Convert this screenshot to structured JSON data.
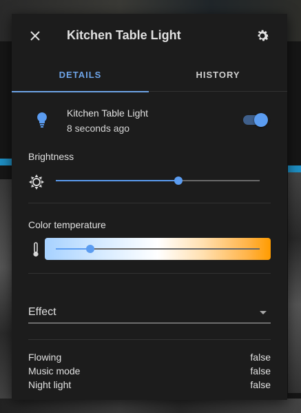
{
  "dialog": {
    "title": "Kitchen Table Light",
    "close_icon": "close-icon",
    "settings_icon": "gear-icon"
  },
  "tabs": [
    {
      "label": "DETAILS",
      "active": true
    },
    {
      "label": "HISTORY",
      "active": false
    }
  ],
  "entity": {
    "name": "Kitchen Table Light",
    "last_changed": "8 seconds ago",
    "icon": "lightbulb-icon",
    "state_on": true
  },
  "brightness": {
    "label": "Brightness",
    "icon": "brightness-icon",
    "value_fraction": 0.6
  },
  "color_temperature": {
    "label": "Color temperature",
    "icon": "thermometer-icon",
    "value_fraction": 0.17
  },
  "effect": {
    "label": "Effect",
    "icon": "dropdown-arrow-icon"
  },
  "attributes": [
    {
      "key": "Flowing",
      "value": "false"
    },
    {
      "key": "Music mode",
      "value": "false"
    },
    {
      "key": "Night light",
      "value": "false"
    }
  ],
  "colors": {
    "accent": "#5b9cf0",
    "background": "#1c1c1c",
    "text": "#e1e1e1"
  }
}
